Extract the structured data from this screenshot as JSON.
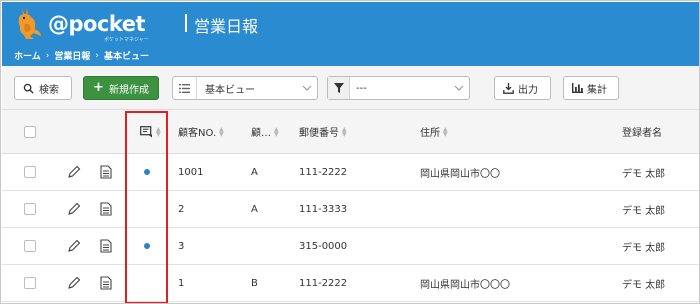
{
  "header": {
    "logo_text": "@pocket",
    "logo_sub": "ポケットマネジャー",
    "app_title": "営業日報",
    "breadcrumb": [
      "ホーム",
      "営業日報",
      "基本ビュー"
    ]
  },
  "toolbar": {
    "search_label": "検索",
    "new_label": "新規作成",
    "view_value": "基本ビュー",
    "filter_value": "---",
    "export_label": "出力",
    "sum_label": "集計"
  },
  "table": {
    "columns": [
      "顧客NO.",
      "顧…",
      "郵便番号",
      "住所",
      "登録者名"
    ],
    "rows": [
      {
        "flag": true,
        "no": "1001",
        "cat": "A",
        "zip": "111-2222",
        "addr": "岡山県岡山市〇〇",
        "owner": "デモ 太郎"
      },
      {
        "flag": false,
        "no": "2",
        "cat": "A",
        "zip": "111-3333",
        "addr": "",
        "owner": "デモ 太郎"
      },
      {
        "flag": true,
        "no": "3",
        "cat": "",
        "zip": "315-0000",
        "addr": "",
        "owner": "デモ 太郎"
      },
      {
        "flag": false,
        "no": "1",
        "cat": "B",
        "zip": "111-2222",
        "addr": "岡山県岡山市〇〇〇",
        "owner": "デモ 太郎"
      }
    ]
  },
  "colors": {
    "header_bg": "#2a8bd0",
    "new_button_bg": "#3c9240",
    "flag_dot": "#2a82c8",
    "highlight_border": "#e02020"
  },
  "icons": [
    "kangaroo-logo-icon",
    "search-icon",
    "plus-icon",
    "list-icon",
    "chevron-down-icon",
    "filter-icon",
    "download-icon",
    "bar-chart-icon",
    "memo-flag-icon",
    "sort-icon",
    "edit-pencil-icon",
    "document-icon"
  ]
}
